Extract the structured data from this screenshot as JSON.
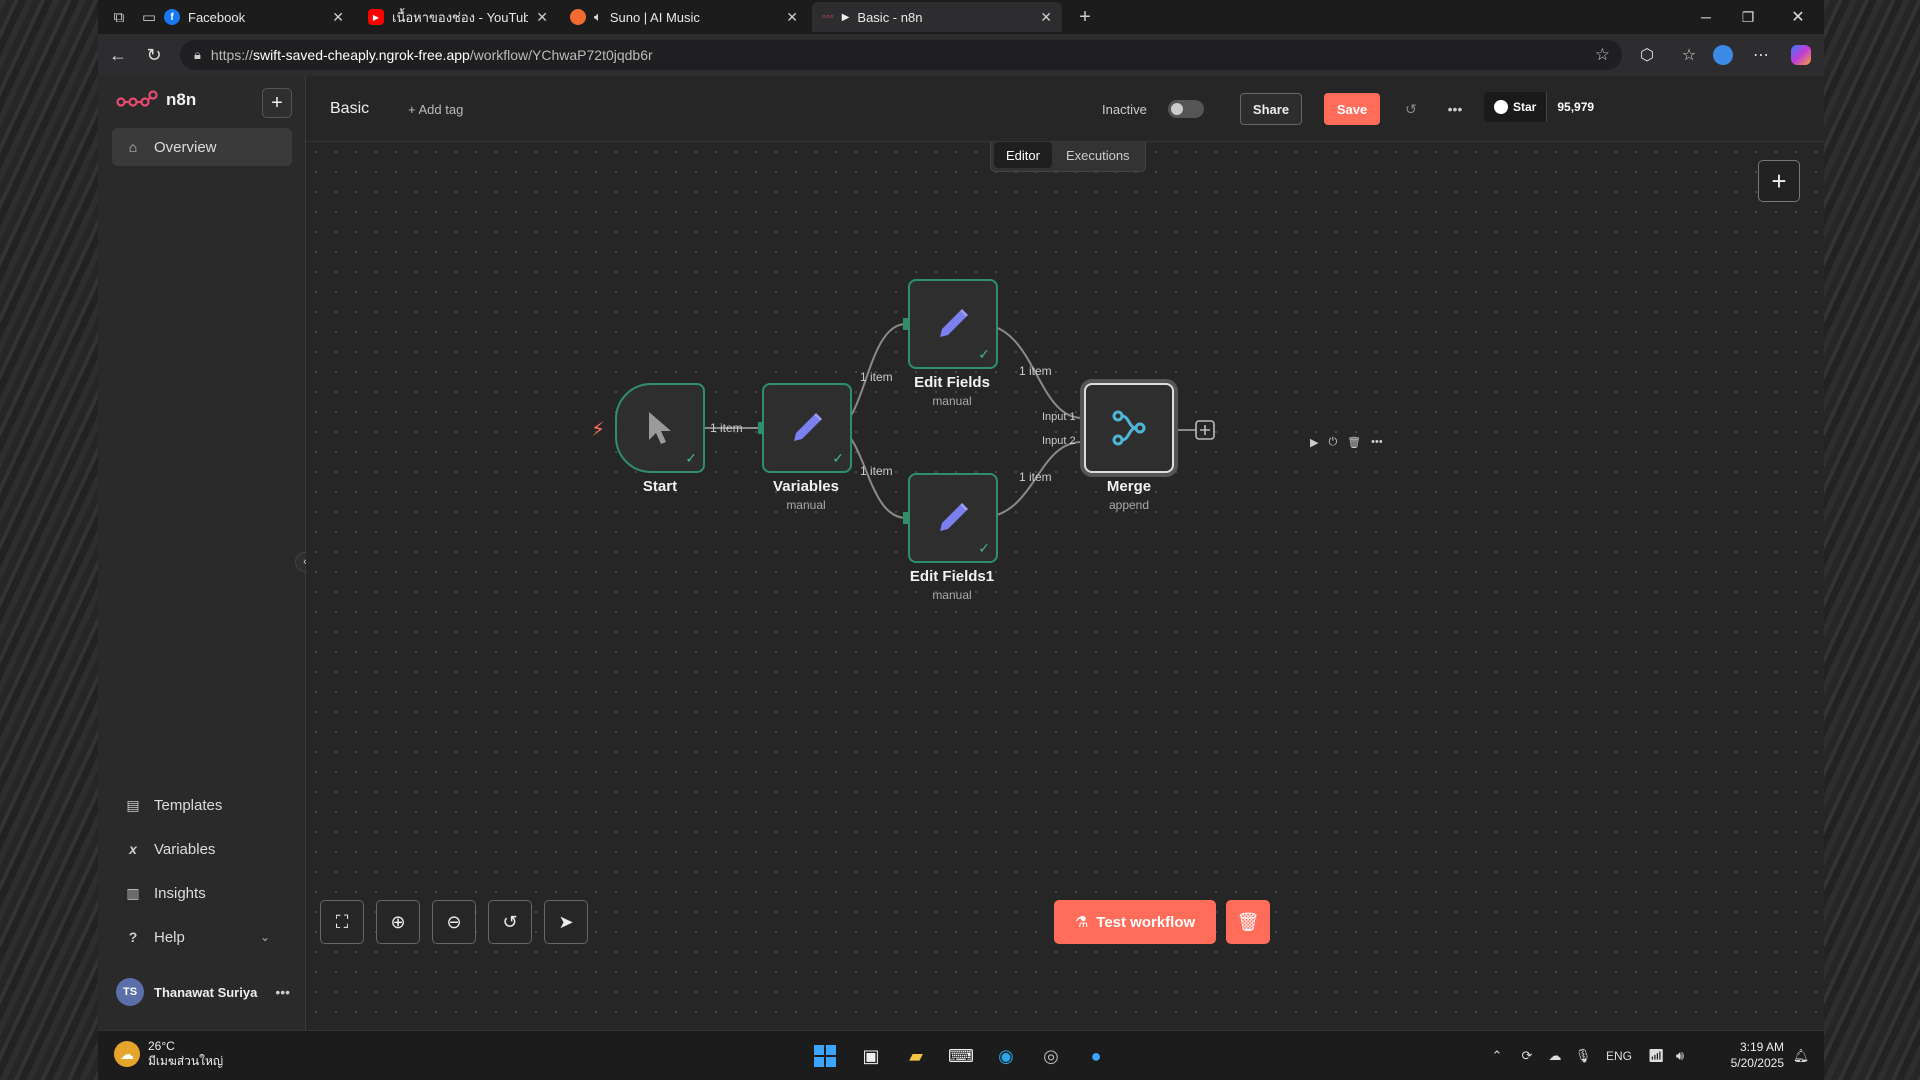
{
  "browser": {
    "tabs": [
      {
        "title": "Facebook",
        "favicon": "f",
        "color": "#1877f2"
      },
      {
        "title": "เนื้อหาของช่อง - YouTube Studio",
        "favicon": "▶",
        "color": "#ff0000"
      },
      {
        "title": "Suno | AI Music",
        "favicon": "",
        "color": "#f26a2e"
      },
      {
        "title": "Basic - n8n",
        "favicon": "",
        "color": "#ea4b71"
      }
    ],
    "url_prefix": "https://",
    "url_host": "swift-saved-cheaply.ngrok-free.app",
    "url_path": "/workflow/YChwaP72t0jqdb6r"
  },
  "sidebar": {
    "logo_text": "n8n",
    "top_items": [
      {
        "label": "Overview",
        "icon": "home-icon"
      }
    ],
    "bottom_items": [
      {
        "label": "Templates",
        "icon": "templates-icon"
      },
      {
        "label": "Variables",
        "icon": "variables-icon"
      },
      {
        "label": "Insights",
        "icon": "insights-icon"
      },
      {
        "label": "Help",
        "icon": "help-icon"
      }
    ],
    "user": {
      "initials": "TS",
      "name": "Thanawat Suriya"
    }
  },
  "header": {
    "workflow_name": "Basic",
    "add_tag": "+ Add tag",
    "status": "Inactive",
    "share_label": "Share",
    "save_label": "Save",
    "github_star_label": "Star",
    "github_star_count": "95,979"
  },
  "canvas": {
    "view_tabs": [
      {
        "label": "Editor",
        "active": true
      },
      {
        "label": "Executions",
        "active": false
      }
    ],
    "nodes": [
      {
        "id": "start",
        "title": "Start",
        "subtitle": ""
      },
      {
        "id": "variables",
        "title": "Variables",
        "subtitle": "manual"
      },
      {
        "id": "edit_fields",
        "title": "Edit Fields",
        "subtitle": "manual"
      },
      {
        "id": "edit_fields1",
        "title": "Edit Fields1",
        "subtitle": "manual"
      },
      {
        "id": "merge",
        "title": "Merge",
        "subtitle": "append"
      }
    ],
    "edge_labels": {
      "start_variables": "1 item",
      "variables_edit": "1 item",
      "variables_edit1": "1 item",
      "edit_merge": "1 item",
      "edit1_merge": "1 item"
    },
    "merge_inputs": [
      "Input 1",
      "Input 2"
    ],
    "test_workflow_label": "Test workflow"
  },
  "taskbar": {
    "temperature": "26°C",
    "weather_desc": "มีเมฆส่วนใหญ่",
    "language": "ENG",
    "time": "3:19 AM",
    "date": "5/20/2025"
  },
  "colors": {
    "accent": "#ff6d5a",
    "node_success_border": "#2f8f6a",
    "edit_icon": "#7b7ff0",
    "merge_icon": "#4fb6d8"
  }
}
